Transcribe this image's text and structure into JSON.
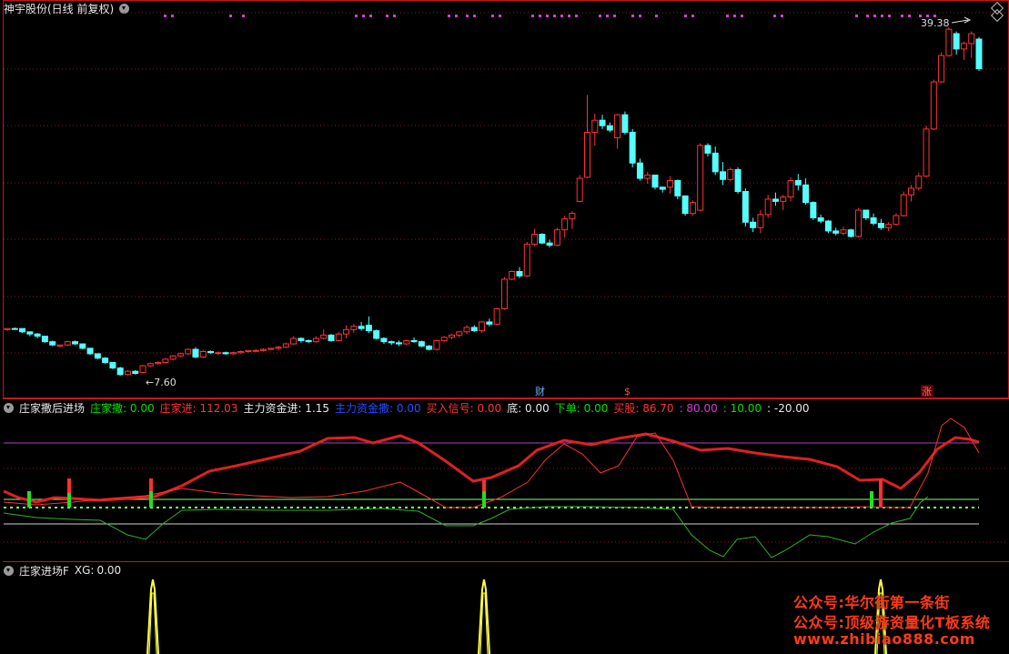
{
  "main_panel": {
    "title": "神宇股份(日线 前复权)",
    "high_label": "39.38",
    "low_label": "7.60",
    "markers": {
      "cai": "财",
      "s": "$",
      "zhang": "涨"
    }
  },
  "indicator1": {
    "name": "庄家撒后进场",
    "fields": [
      {
        "label": "庄家撒:",
        "value": "0.00",
        "color": "#00e000"
      },
      {
        "label": "庄家进:",
        "value": "112.03",
        "color": "#ff3333"
      },
      {
        "label": "主力资金进:",
        "value": "1.15",
        "color": "#e8e8e8"
      },
      {
        "label": "主力资金撒:",
        "value": "0.00",
        "color": "#2a4cff"
      },
      {
        "label": "买入信号:",
        "value": "0.00",
        "color": "#ff3333"
      },
      {
        "label": "底:",
        "value": "0.00",
        "color": "#e8e8e8"
      },
      {
        "label": "下单:",
        "value": "0.00",
        "color": "#00e000"
      },
      {
        "label": "买股:",
        "value": "86.70",
        "color": "#ff3333"
      },
      {
        "label": ":",
        "value": "80.00",
        "color": "#d43fd4"
      },
      {
        "label": ":",
        "value": "10.00",
        "color": "#00e000"
      },
      {
        "label": ":",
        "value": "-20.00",
        "color": "#e8e8e8"
      }
    ]
  },
  "indicator2": {
    "name": "庄家进场F",
    "xg_label": "XG:",
    "xg_value": "0.00"
  },
  "watermark": {
    "line1": "公众号:华尔街第一条街",
    "line2": "公众号:顶级游资量化T板系统",
    "line3": "www.zhibiao888.com"
  },
  "colors": {
    "up": "#ff3333",
    "down": "#54ffff",
    "grid": "#8a1a1a",
    "magenta_dot": "#d43fd4",
    "red_line": "#e02020",
    "green_line": "#2fb02f",
    "purple_line": "#b040c0",
    "light_green_line": "#80ff80",
    "yellow": "#ffff40"
  },
  "chart_data": {
    "type": "candlestick",
    "price_range": [
      7.6,
      39.38
    ],
    "ohlc": [
      [
        11.8,
        11.9,
        11.7,
        11.9
      ],
      [
        11.9,
        12.0,
        11.8,
        11.85
      ],
      [
        11.9,
        11.9,
        11.5,
        11.6
      ],
      [
        11.6,
        11.6,
        11.2,
        11.4
      ],
      [
        11.4,
        11.5,
        11.0,
        11.2
      ],
      [
        11.2,
        11.2,
        10.6,
        10.7
      ],
      [
        10.7,
        10.8,
        10.3,
        10.4
      ],
      [
        10.3,
        10.4,
        10.2,
        10.4
      ],
      [
        10.4,
        10.8,
        10.3,
        10.7
      ],
      [
        10.7,
        10.8,
        10.4,
        10.5
      ],
      [
        10.5,
        10.5,
        10.0,
        10.1
      ],
      [
        10.1,
        10.1,
        9.5,
        9.6
      ],
      [
        9.6,
        9.6,
        9.1,
        9.2
      ],
      [
        9.2,
        9.3,
        8.7,
        8.8
      ],
      [
        8.8,
        8.8,
        8.2,
        8.3
      ],
      [
        8.3,
        8.4,
        7.6,
        7.7
      ],
      [
        7.7,
        8.1,
        7.6,
        8.0
      ],
      [
        8.0,
        8.1,
        7.7,
        7.8
      ],
      [
        7.9,
        8.6,
        7.8,
        8.5
      ],
      [
        8.5,
        8.8,
        8.4,
        8.7
      ],
      [
        8.7,
        8.9,
        8.6,
        8.8
      ],
      [
        8.8,
        9.2,
        8.7,
        9.1
      ],
      [
        9.1,
        9.5,
        9.0,
        9.4
      ],
      [
        9.4,
        9.7,
        9.3,
        9.6
      ],
      [
        9.6,
        10.1,
        9.5,
        10.0
      ],
      [
        10.0,
        10.2,
        9.2,
        9.3
      ],
      [
        9.3,
        9.9,
        9.2,
        9.8
      ],
      [
        9.8,
        9.9,
        9.6,
        9.7
      ],
      [
        9.7,
        9.8,
        9.5,
        9.7
      ],
      [
        9.7,
        9.8,
        9.5,
        9.6
      ],
      [
        9.6,
        9.8,
        9.5,
        9.7
      ],
      [
        9.7,
        9.9,
        9.6,
        9.8
      ],
      [
        9.8,
        9.9,
        9.7,
        9.9
      ],
      [
        9.9,
        10.0,
        9.8,
        9.9
      ],
      [
        9.9,
        10.1,
        9.8,
        10.0
      ],
      [
        10.0,
        10.1,
        9.9,
        10.1
      ],
      [
        10.1,
        10.3,
        9.9,
        10.2
      ],
      [
        10.2,
        10.6,
        10.1,
        10.5
      ],
      [
        10.5,
        11.2,
        10.4,
        11.0
      ],
      [
        11.0,
        11.1,
        10.6,
        10.8
      ],
      [
        10.8,
        10.9,
        10.6,
        10.7
      ],
      [
        10.7,
        11.2,
        10.6,
        11.0
      ],
      [
        11.0,
        11.8,
        10.9,
        11.3
      ],
      [
        11.3,
        11.4,
        10.7,
        10.8
      ],
      [
        10.8,
        11.6,
        10.7,
        11.4
      ],
      [
        11.4,
        12.2,
        11.0,
        11.8
      ],
      [
        11.8,
        12.3,
        11.5,
        12.1
      ],
      [
        12.1,
        12.5,
        11.7,
        11.9
      ],
      [
        12.2,
        13.0,
        11.5,
        11.7
      ],
      [
        11.7,
        11.8,
        10.9,
        11.0
      ],
      [
        11.0,
        11.1,
        10.5,
        10.7
      ],
      [
        10.7,
        10.8,
        10.4,
        10.6
      ],
      [
        10.6,
        10.8,
        10.3,
        10.5
      ],
      [
        10.5,
        10.9,
        10.4,
        10.8
      ],
      [
        10.8,
        11.1,
        10.6,
        10.7
      ],
      [
        10.7,
        10.8,
        10.2,
        10.3
      ],
      [
        10.3,
        10.4,
        9.9,
        10.0
      ],
      [
        10.0,
        10.9,
        9.9,
        10.8
      ],
      [
        10.8,
        11.2,
        10.7,
        11.1
      ],
      [
        11.1,
        11.4,
        10.9,
        11.3
      ],
      [
        11.3,
        11.7,
        11.1,
        11.6
      ],
      [
        11.6,
        12.2,
        11.4,
        12.0
      ],
      [
        12.0,
        12.2,
        11.6,
        11.7
      ],
      [
        11.7,
        12.6,
        11.5,
        12.5
      ],
      [
        12.5,
        12.8,
        12.1,
        12.3
      ],
      [
        12.3,
        13.8,
        12.2,
        13.7
      ],
      [
        13.7,
        16.6,
        13.6,
        16.4
      ],
      [
        16.4,
        17.2,
        16.3,
        17.1
      ],
      [
        17.1,
        17.5,
        16.5,
        16.7
      ],
      [
        16.7,
        19.8,
        16.6,
        19.6
      ],
      [
        19.6,
        21.0,
        19.4,
        20.5
      ],
      [
        20.5,
        20.6,
        19.6,
        19.7
      ],
      [
        19.7,
        20.0,
        19.3,
        19.5
      ],
      [
        19.5,
        21.1,
        19.4,
        20.9
      ],
      [
        20.9,
        22.2,
        20.2,
        21.9
      ],
      [
        21.9,
        22.6,
        21.0,
        22.4
      ],
      [
        23.5,
        25.9,
        23.4,
        25.6
      ],
      [
        25.7,
        33.2,
        25.6,
        29.8
      ],
      [
        29.8,
        31.5,
        28.6,
        30.9
      ],
      [
        30.9,
        31.4,
        30.1,
        30.4
      ],
      [
        30.4,
        30.7,
        29.8,
        30.0
      ],
      [
        29.3,
        31.5,
        28.3,
        31.4
      ],
      [
        31.4,
        31.7,
        29.6,
        29.8
      ],
      [
        29.8,
        30.1,
        26.6,
        27.0
      ],
      [
        27.0,
        27.4,
        25.4,
        25.6
      ],
      [
        25.6,
        26.2,
        25.1,
        25.9
      ],
      [
        25.9,
        25.9,
        24.6,
        24.8
      ],
      [
        24.8,
        24.8,
        24.3,
        24.6
      ],
      [
        24.8,
        25.8,
        24.2,
        25.4
      ],
      [
        25.4,
        25.5,
        23.7,
        24.0
      ],
      [
        24.0,
        24.0,
        22.2,
        22.4
      ],
      [
        22.4,
        23.6,
        22.2,
        23.4
      ],
      [
        22.7,
        28.8,
        22.6,
        28.6
      ],
      [
        28.6,
        28.8,
        27.6,
        27.9
      ],
      [
        27.9,
        28.5,
        25.9,
        26.2
      ],
      [
        26.2,
        27.1,
        25.0,
        25.5
      ],
      [
        25.5,
        26.6,
        25.3,
        26.4
      ],
      [
        26.4,
        26.6,
        24.2,
        24.4
      ],
      [
        24.4,
        24.7,
        21.2,
        21.6
      ],
      [
        21.6,
        22.0,
        20.7,
        21.1
      ],
      [
        21.1,
        22.7,
        20.6,
        22.3
      ],
      [
        22.3,
        24.1,
        22.0,
        23.7
      ],
      [
        23.7,
        24.3,
        23.1,
        23.5
      ],
      [
        23.5,
        24.1,
        22.7,
        23.9
      ],
      [
        23.9,
        25.7,
        23.5,
        25.4
      ],
      [
        25.4,
        26.0,
        24.5,
        25.0
      ],
      [
        25.0,
        25.6,
        23.2,
        23.4
      ],
      [
        23.4,
        23.5,
        21.8,
        22.0
      ],
      [
        22.0,
        22.3,
        21.5,
        21.7
      ],
      [
        21.7,
        21.8,
        20.6,
        20.8
      ],
      [
        20.8,
        21.1,
        20.4,
        20.6
      ],
      [
        20.6,
        21.2,
        20.4,
        20.9
      ],
      [
        20.9,
        21.0,
        20.2,
        20.3
      ],
      [
        20.3,
        22.9,
        20.2,
        22.7
      ],
      [
        22.7,
        22.7,
        21.8,
        22.0
      ],
      [
        22.0,
        22.4,
        21.3,
        21.5
      ],
      [
        21.5,
        21.9,
        20.9,
        21.1
      ],
      [
        21.1,
        21.6,
        20.8,
        21.4
      ],
      [
        21.4,
        22.4,
        21.3,
        22.2
      ],
      [
        22.2,
        24.4,
        22.1,
        24.1
      ],
      [
        24.1,
        25.0,
        23.5,
        24.7
      ],
      [
        24.7,
        26.1,
        24.5,
        25.8
      ],
      [
        25.8,
        30.4,
        25.7,
        30.1
      ],
      [
        30.1,
        34.6,
        30.0,
        34.4
      ],
      [
        34.4,
        37.1,
        34.3,
        36.8
      ],
      [
        36.8,
        39.4,
        36.7,
        39.2
      ],
      [
        38.8,
        39.0,
        36.9,
        37.4
      ],
      [
        37.4,
        38.1,
        36.4,
        37.9
      ],
      [
        37.9,
        39.0,
        36.6,
        38.8
      ],
      [
        38.3,
        38.5,
        35.4,
        35.6
      ]
    ]
  }
}
